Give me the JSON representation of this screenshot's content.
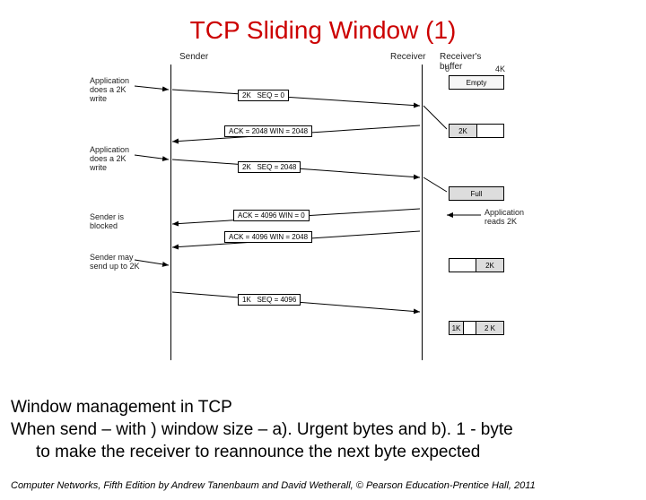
{
  "title": "TCP Sliding Window (1)",
  "headers": {
    "sender": "Sender",
    "receiver": "Receiver",
    "receiver_buffer": "Receiver's\nbuffer"
  },
  "side_labels": {
    "app_write_1": "Application\ndoes a 2K\nwrite",
    "app_write_2": "Application\ndoes a 2K\nwrite",
    "blocked": "Sender is\nblocked",
    "may_send": "Sender may\nsend up to 2K",
    "app_reads": "Application\nreads 2K"
  },
  "buffers": {
    "row0_left_mark": "0",
    "row0_right_mark": "4K",
    "row0": "Empty",
    "row1_fill": "2K",
    "row2": "Full",
    "row3_fill": "2K",
    "row4_left": "1K",
    "row4_mid": "2 K"
  },
  "messages": {
    "m1_left": "2K",
    "m1_right": "SEQ = 0",
    "m2": "ACK = 2048 WIN = 2048",
    "m3_left": "2K",
    "m3_right": "SEQ = 2048",
    "m4": "ACK = 4096 WIN = 0",
    "m5": "ACK = 4096 WIN = 2048",
    "m6_left": "1K",
    "m6_right": "SEQ = 4096"
  },
  "body": {
    "line1": "Window management in TCP",
    "line2": "When send – with ) window size – a). Urgent bytes and b).  1 - byte",
    "line3": "to make the receiver to reannounce the next byte expected"
  },
  "footer": {
    "book": "Computer Networks",
    "rest": ", Fifth Edition by Andrew Tanenbaum and David Wetherall, © Pearson Education-Prentice Hall, 2011"
  }
}
